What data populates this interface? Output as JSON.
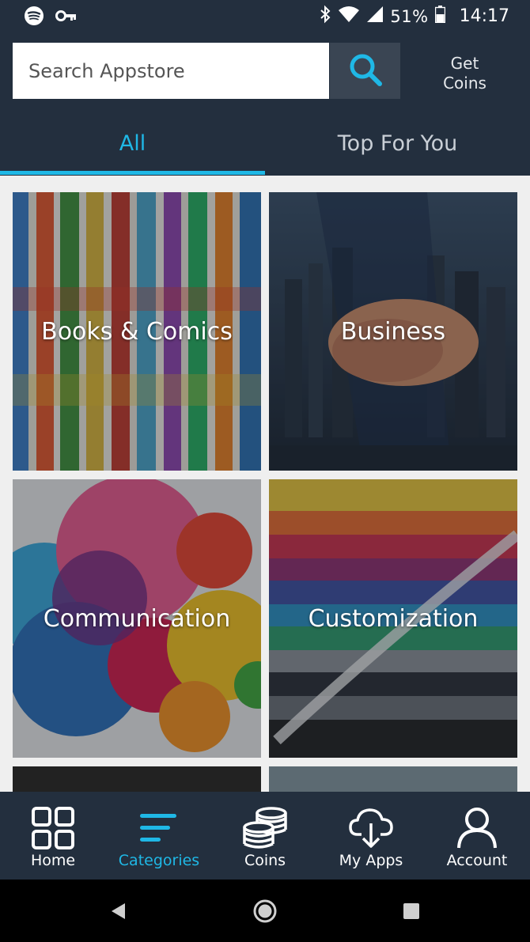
{
  "status_bar": {
    "battery_percent": "51%",
    "time": "14:17",
    "icons": [
      "spotify-icon",
      "vpn-key-icon",
      "bluetooth-icon",
      "wifi-icon",
      "signal-icon",
      "battery-icon"
    ]
  },
  "search": {
    "placeholder": "Search Appstore"
  },
  "header": {
    "get_coins_line1": "Get",
    "get_coins_line2": "Coins"
  },
  "tabs": [
    {
      "label": "All",
      "active": true
    },
    {
      "label": "Top For You",
      "active": false
    }
  ],
  "categories": [
    {
      "label": "Books & Comics"
    },
    {
      "label": "Business"
    },
    {
      "label": "Communication"
    },
    {
      "label": "Customization"
    }
  ],
  "bottom_nav": [
    {
      "label": "Home",
      "icon": "grid-icon"
    },
    {
      "label": "Categories",
      "icon": "list-icon",
      "active": true
    },
    {
      "label": "Coins",
      "icon": "coins-icon"
    },
    {
      "label": "My Apps",
      "icon": "cloud-download-icon"
    },
    {
      "label": "Account",
      "icon": "person-icon"
    }
  ],
  "colors": {
    "accent": "#1fb8e6",
    "header_bg": "#232f3e",
    "content_bg": "#efefef"
  }
}
